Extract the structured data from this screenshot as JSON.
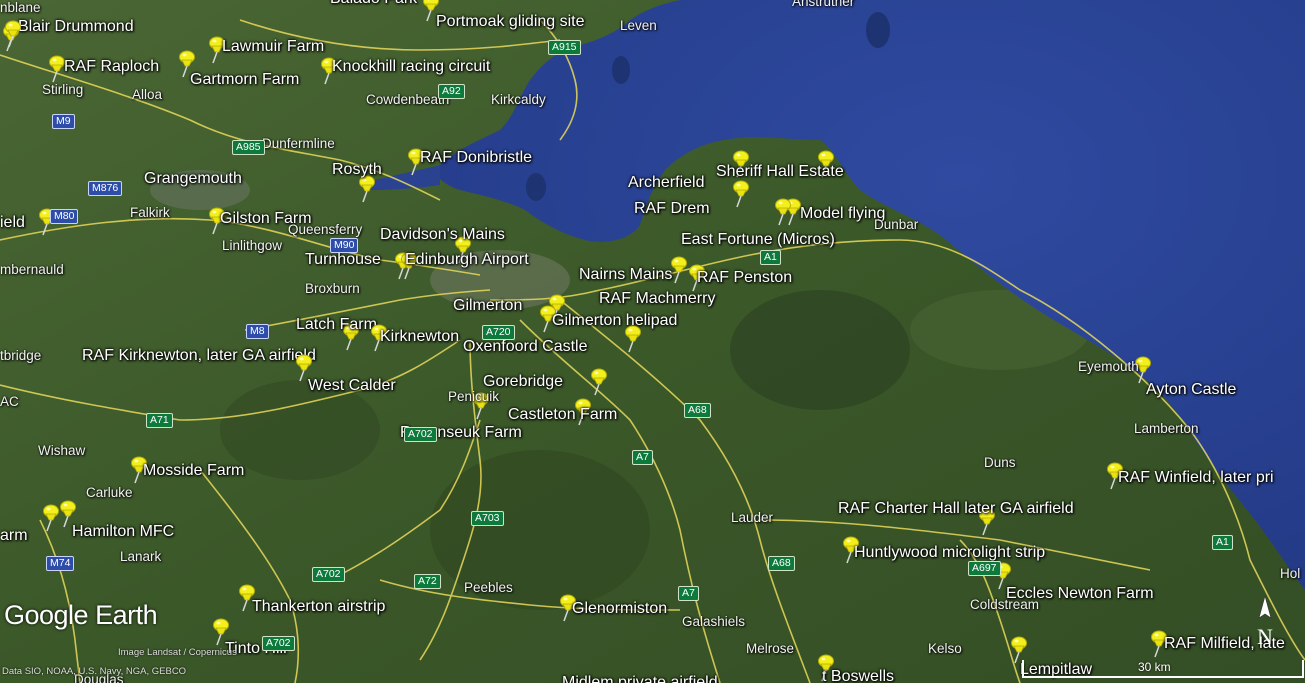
{
  "app": {
    "name": "Google Earth"
  },
  "attribution": {
    "line1": "Image Landsat / Copernicus",
    "line2": "Data SIO, NOAA, U.S. Navy, NGA, GEBCO"
  },
  "scale": {
    "label": "30 km"
  },
  "compass": {
    "label": "N"
  },
  "placemarks": [
    {
      "id": "blair-drummond",
      "label": "Blair Drummond"
    },
    {
      "id": "raf-raploch",
      "label": "RAF Raploch"
    },
    {
      "id": "lawmuir-farm",
      "label": "Lawmuir Farm"
    },
    {
      "id": "gartmorn-farm",
      "label": "Gartmorn Farm"
    },
    {
      "id": "knockhill",
      "label": "Knockhill racing circuit"
    },
    {
      "id": "portmoak",
      "label": "Portmoak gliding site"
    },
    {
      "id": "grangemouth",
      "label": "Grangemouth"
    },
    {
      "id": "gilston-farm",
      "label": "Gilston Farm"
    },
    {
      "id": "rosyth",
      "label": "Rosyth"
    },
    {
      "id": "raf-donibristle",
      "label": "RAF Donibristle"
    },
    {
      "id": "davidsons-mains",
      "label": "Davidson's Mains"
    },
    {
      "id": "turnhouse",
      "label": "Turnhouse"
    },
    {
      "id": "edinburgh-airport",
      "label": "Edinburgh Airport"
    },
    {
      "id": "archerfield",
      "label": "Archerfield"
    },
    {
      "id": "sheriff-hall",
      "label": "Sheriff Hall Estate"
    },
    {
      "id": "raf-drem",
      "label": "RAF Drem"
    },
    {
      "id": "model-flying",
      "label": "Model flying"
    },
    {
      "id": "east-fortune",
      "label": "East Fortune (Micros)"
    },
    {
      "id": "nairns-mains",
      "label": "Nairns Mains"
    },
    {
      "id": "raf-penston",
      "label": "RAF Penston"
    },
    {
      "id": "raf-macmerry",
      "label": "RAF Machmerry"
    },
    {
      "id": "gilmerton",
      "label": "Gilmerton"
    },
    {
      "id": "gilmerton-helipad",
      "label": "Gilmerton helipad"
    },
    {
      "id": "latch-farm",
      "label": "Latch Farm"
    },
    {
      "id": "kirknewton",
      "label": "Kirknewton"
    },
    {
      "id": "oxenfoord",
      "label": "Oxenfoord Castle"
    },
    {
      "id": "raf-kirknewton",
      "label": "RAF Kirknewton, later GA airfield"
    },
    {
      "id": "west-calder",
      "label": "West Calder"
    },
    {
      "id": "gorebridge",
      "label": "Gorebridge"
    },
    {
      "id": "castleton-farm",
      "label": "Castleton Farm"
    },
    {
      "id": "ravenseuk-farm",
      "label": "Ravenseuk Farm"
    },
    {
      "id": "ayton-castle",
      "label": "Ayton Castle"
    },
    {
      "id": "mosside-farm",
      "label": "Mosside Farm"
    },
    {
      "id": "raf-winfield",
      "label": "RAF Winfield, later pri"
    },
    {
      "id": "raf-charter-hall",
      "label": "RAF Charter Hall later GA airfield"
    },
    {
      "id": "hamilton-mfc",
      "label": "Hamilton MFC"
    },
    {
      "id": "arm-left",
      "label": "arm"
    },
    {
      "id": "huntlywood",
      "label": "Huntlywood microlight strip"
    },
    {
      "id": "eccles-newton",
      "label": "Eccles Newton Farm"
    },
    {
      "id": "thankerton",
      "label": "Thankerton airstrip"
    },
    {
      "id": "glenormiston",
      "label": "Glenormiston"
    },
    {
      "id": "tinto-hill",
      "label": "Tinto Hill"
    },
    {
      "id": "raf-milfield",
      "label": "RAF Milfield, late"
    },
    {
      "id": "lempitlaw",
      "label": "Lempitlaw"
    },
    {
      "id": "st-boswells",
      "label": "t Boswells"
    },
    {
      "id": "midlem",
      "label": "Midlem private airfield"
    },
    {
      "id": "balado-park",
      "label": "Balado Park"
    },
    {
      "id": "field-left",
      "label": "ield"
    },
    {
      "id": "edge-pin-left",
      "label": ""
    }
  ],
  "towns": [
    {
      "id": "dunblane",
      "label": "nblane"
    },
    {
      "id": "stirling",
      "label": "Stirling"
    },
    {
      "id": "alloa",
      "label": "Alloa"
    },
    {
      "id": "cowdenbeath",
      "label": "Cowdenbeath"
    },
    {
      "id": "kirkcaldy",
      "label": "Kirkcaldy"
    },
    {
      "id": "leven",
      "label": "Leven"
    },
    {
      "id": "anstruther",
      "label": "Anstruther"
    },
    {
      "id": "dunfermline",
      "label": "Dunfermline"
    },
    {
      "id": "falkirk",
      "label": "Falkirk"
    },
    {
      "id": "linlithgow",
      "label": "Linlithgow"
    },
    {
      "id": "queensferry",
      "label": "Queensferry"
    },
    {
      "id": "cumbernauld",
      "label": "mbernauld"
    },
    {
      "id": "broxburn",
      "label": "Broxburn"
    },
    {
      "id": "bathgate",
      "label": "tbridge"
    },
    {
      "id": "penicuik",
      "label": "Penicuik"
    },
    {
      "id": "dunbar",
      "label": "Dunbar"
    },
    {
      "id": "eyemouth",
      "label": "Eyemouth"
    },
    {
      "id": "lamberton",
      "label": "Lamberton"
    },
    {
      "id": "duns",
      "label": "Duns"
    },
    {
      "id": "wishaw",
      "label": "Wishaw"
    },
    {
      "id": "carluke",
      "label": "Carluke"
    },
    {
      "id": "lanark",
      "label": "Lanark"
    },
    {
      "id": "lauder",
      "label": "Lauder"
    },
    {
      "id": "peebles",
      "label": "Peebles"
    },
    {
      "id": "galashiels",
      "label": "Galashiels"
    },
    {
      "id": "melrose",
      "label": "Melrose"
    },
    {
      "id": "kelso",
      "label": "Kelso"
    },
    {
      "id": "coldstream",
      "label": "Coldstream"
    },
    {
      "id": "douglas",
      "label": "Douglas"
    },
    {
      "id": "holy",
      "label": "Hol"
    },
    {
      "id": "mac",
      "label": "AC"
    }
  ],
  "roads": [
    {
      "id": "a915",
      "label": "A915",
      "kind": "green"
    },
    {
      "id": "a92",
      "label": "A92",
      "kind": "green"
    },
    {
      "id": "m9",
      "label": "M9",
      "kind": "blue"
    },
    {
      "id": "a985",
      "label": "A985",
      "kind": "green"
    },
    {
      "id": "m876",
      "label": "M876",
      "kind": "blue"
    },
    {
      "id": "m80",
      "label": "M80",
      "kind": "blue"
    },
    {
      "id": "m90",
      "label": "M90",
      "kind": "blue"
    },
    {
      "id": "a1-north",
      "label": "A1",
      "kind": "green"
    },
    {
      "id": "m8",
      "label": "M8",
      "kind": "blue"
    },
    {
      "id": "a720",
      "label": "A720",
      "kind": "green"
    },
    {
      "id": "a71",
      "label": "A71",
      "kind": "green"
    },
    {
      "id": "a702-a",
      "label": "A702",
      "kind": "green"
    },
    {
      "id": "a68-a",
      "label": "A68",
      "kind": "green"
    },
    {
      "id": "a7-a",
      "label": "A7",
      "kind": "green"
    },
    {
      "id": "a703",
      "label": "A703",
      "kind": "green"
    },
    {
      "id": "m74",
      "label": "M74",
      "kind": "blue"
    },
    {
      "id": "a702-b",
      "label": "A702",
      "kind": "green"
    },
    {
      "id": "a72",
      "label": "A72",
      "kind": "green"
    },
    {
      "id": "a68-b",
      "label": "A68",
      "kind": "green"
    },
    {
      "id": "a697",
      "label": "A697",
      "kind": "green"
    },
    {
      "id": "a1-south",
      "label": "A1",
      "kind": "green"
    },
    {
      "id": "a7-b",
      "label": "A7",
      "kind": "green"
    },
    {
      "id": "a702-c",
      "label": "A702",
      "kind": "green"
    }
  ],
  "colors": {
    "sea": "#283f94",
    "land": "#3e5a2c",
    "road": "#e8d95a",
    "pin": "#f3ef1d"
  }
}
